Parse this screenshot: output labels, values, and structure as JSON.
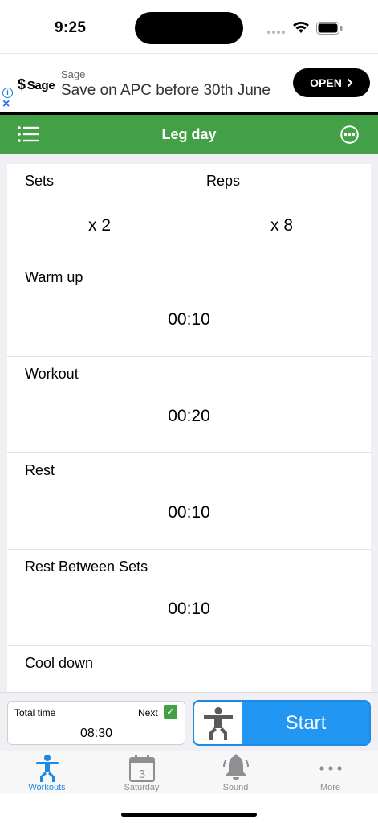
{
  "status_bar": {
    "time": "9:25"
  },
  "ad": {
    "logo_text": "Sage",
    "sponsor": "Sage",
    "headline": "Save on APC before 30th June",
    "cta_label": "OPEN",
    "info_icon": "info-icon",
    "close_icon": "close-icon"
  },
  "header": {
    "title": "Leg day"
  },
  "settings": {
    "sets_label": "Sets",
    "sets_value": "x 2",
    "reps_label": "Reps",
    "reps_value": "x 8",
    "rows": [
      {
        "label": "Warm up",
        "value": "00:10"
      },
      {
        "label": "Workout",
        "value": "00:20"
      },
      {
        "label": "Rest",
        "value": "00:10"
      },
      {
        "label": "Rest Between Sets",
        "value": "00:10"
      },
      {
        "label": "Cool down",
        "value": ""
      }
    ]
  },
  "action_bar": {
    "total_label": "Total time",
    "total_value": "08:30",
    "next_label": "Next",
    "next_checked": true,
    "start_label": "Start"
  },
  "tabs": [
    {
      "label": "Workouts",
      "icon": "figure-icon",
      "active": true
    },
    {
      "label": "Saturday",
      "icon": "calendar-icon",
      "calendar_day": "3"
    },
    {
      "label": "Sound",
      "icon": "bell-icon"
    },
    {
      "label": "More",
      "icon": "more-dots-icon"
    }
  ],
  "colors": {
    "header_green": "#43a047",
    "accent_blue": "#2196f3"
  }
}
